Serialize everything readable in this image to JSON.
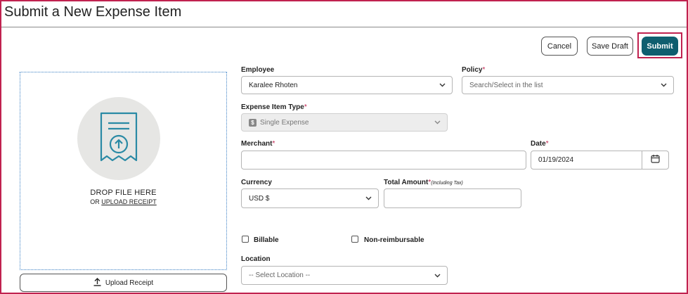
{
  "page": {
    "title": "Submit a New Expense Item"
  },
  "toolbar": {
    "cancel_label": "Cancel",
    "save_draft_label": "Save Draft",
    "submit_label": "Submit"
  },
  "receipt": {
    "drop_title": "DROP FILE HERE",
    "drop_or": "OR ",
    "drop_link": "UPLOAD RECEIPT",
    "upload_button_label": "Upload Receipt",
    "icon": "receipt-upload-icon"
  },
  "form": {
    "employee": {
      "label": "Employee",
      "value": "Karalee Rhoten"
    },
    "policy": {
      "label": "Policy",
      "required": "*",
      "placeholder": "Search/Select in the list"
    },
    "expense_item_type": {
      "label": "Expense Item Type",
      "required": "*",
      "value": "Single Expense",
      "icon": "dollar-icon"
    },
    "merchant": {
      "label": "Merchant",
      "required": "*",
      "value": ""
    },
    "date": {
      "label": "Date",
      "required": "*",
      "value": "01/19/2024",
      "icon": "calendar-icon"
    },
    "currency": {
      "label": "Currency",
      "value": "USD $"
    },
    "total_amount": {
      "label": "Total Amount",
      "required": "*",
      "note": "(Including Tax)",
      "value": ""
    },
    "billable": {
      "label": "Billable",
      "checked": false
    },
    "non_reimbursable": {
      "label": "Non-reimbursable",
      "checked": false
    },
    "location": {
      "label": "Location",
      "placeholder": "-- Select Location --"
    }
  },
  "colors": {
    "accent": "#0f5e6f",
    "highlight": "#c0224f",
    "required": "#c0224f",
    "dropzone_border": "#3a7fc4"
  }
}
